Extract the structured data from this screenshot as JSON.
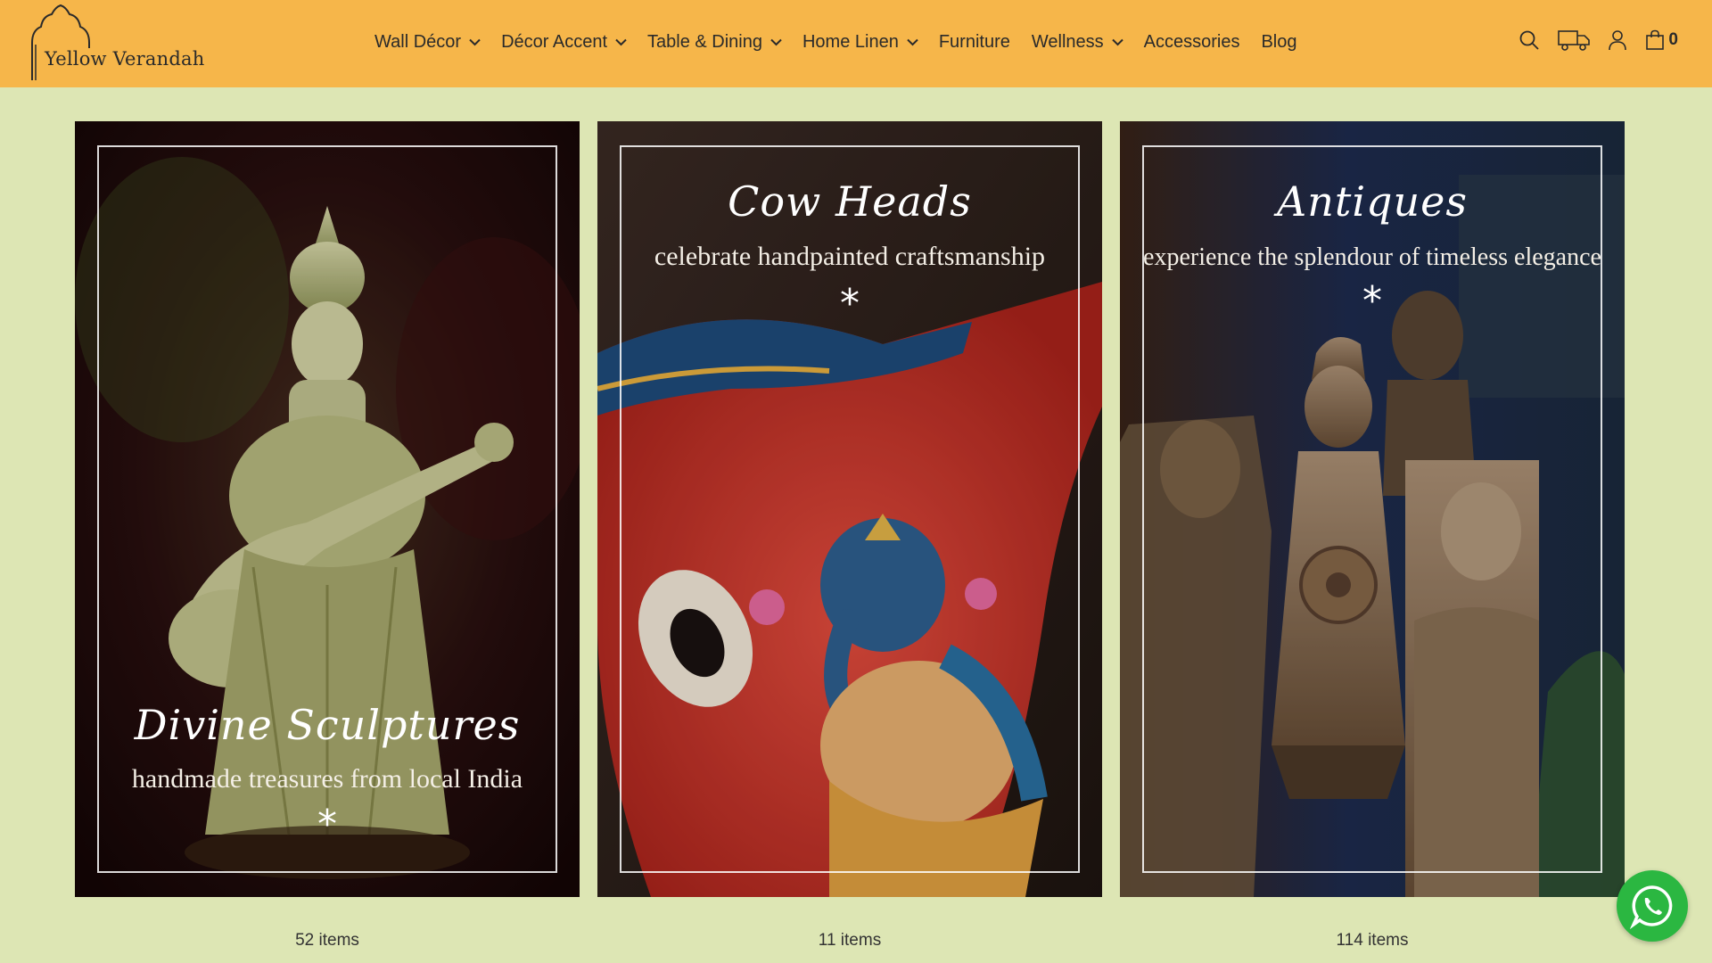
{
  "brand": {
    "name": "Yellow Verandah"
  },
  "nav": [
    {
      "label": "Wall Décor",
      "dropdown": true
    },
    {
      "label": "Décor Accent",
      "dropdown": true
    },
    {
      "label": "Table & Dining",
      "dropdown": true
    },
    {
      "label": "Home Linen",
      "dropdown": true
    },
    {
      "label": "Furniture",
      "dropdown": false
    },
    {
      "label": "Wellness",
      "dropdown": true
    },
    {
      "label": "Accessories",
      "dropdown": false
    },
    {
      "label": "Blog",
      "dropdown": false
    }
  ],
  "header_icons": [
    "search-icon",
    "delivery-truck-icon",
    "user-icon",
    "shopping-bag-icon"
  ],
  "cart": {
    "count": "0"
  },
  "collections": [
    {
      "title": "Divine Sculptures",
      "subtitle": "handmade treasures from local India",
      "star": "*",
      "count": "52 items"
    },
    {
      "title": "Cow Heads",
      "subtitle": "celebrate handpainted craftsmanship",
      "star": "*",
      "count": "11 items"
    },
    {
      "title": "Antiques",
      "subtitle": "experience the splendour of timeless elegance",
      "star": "*",
      "count": "114 items"
    }
  ],
  "colors": {
    "header": "#f6b64a",
    "page": "#dde6b4",
    "whatsapp": "#2bb741"
  }
}
